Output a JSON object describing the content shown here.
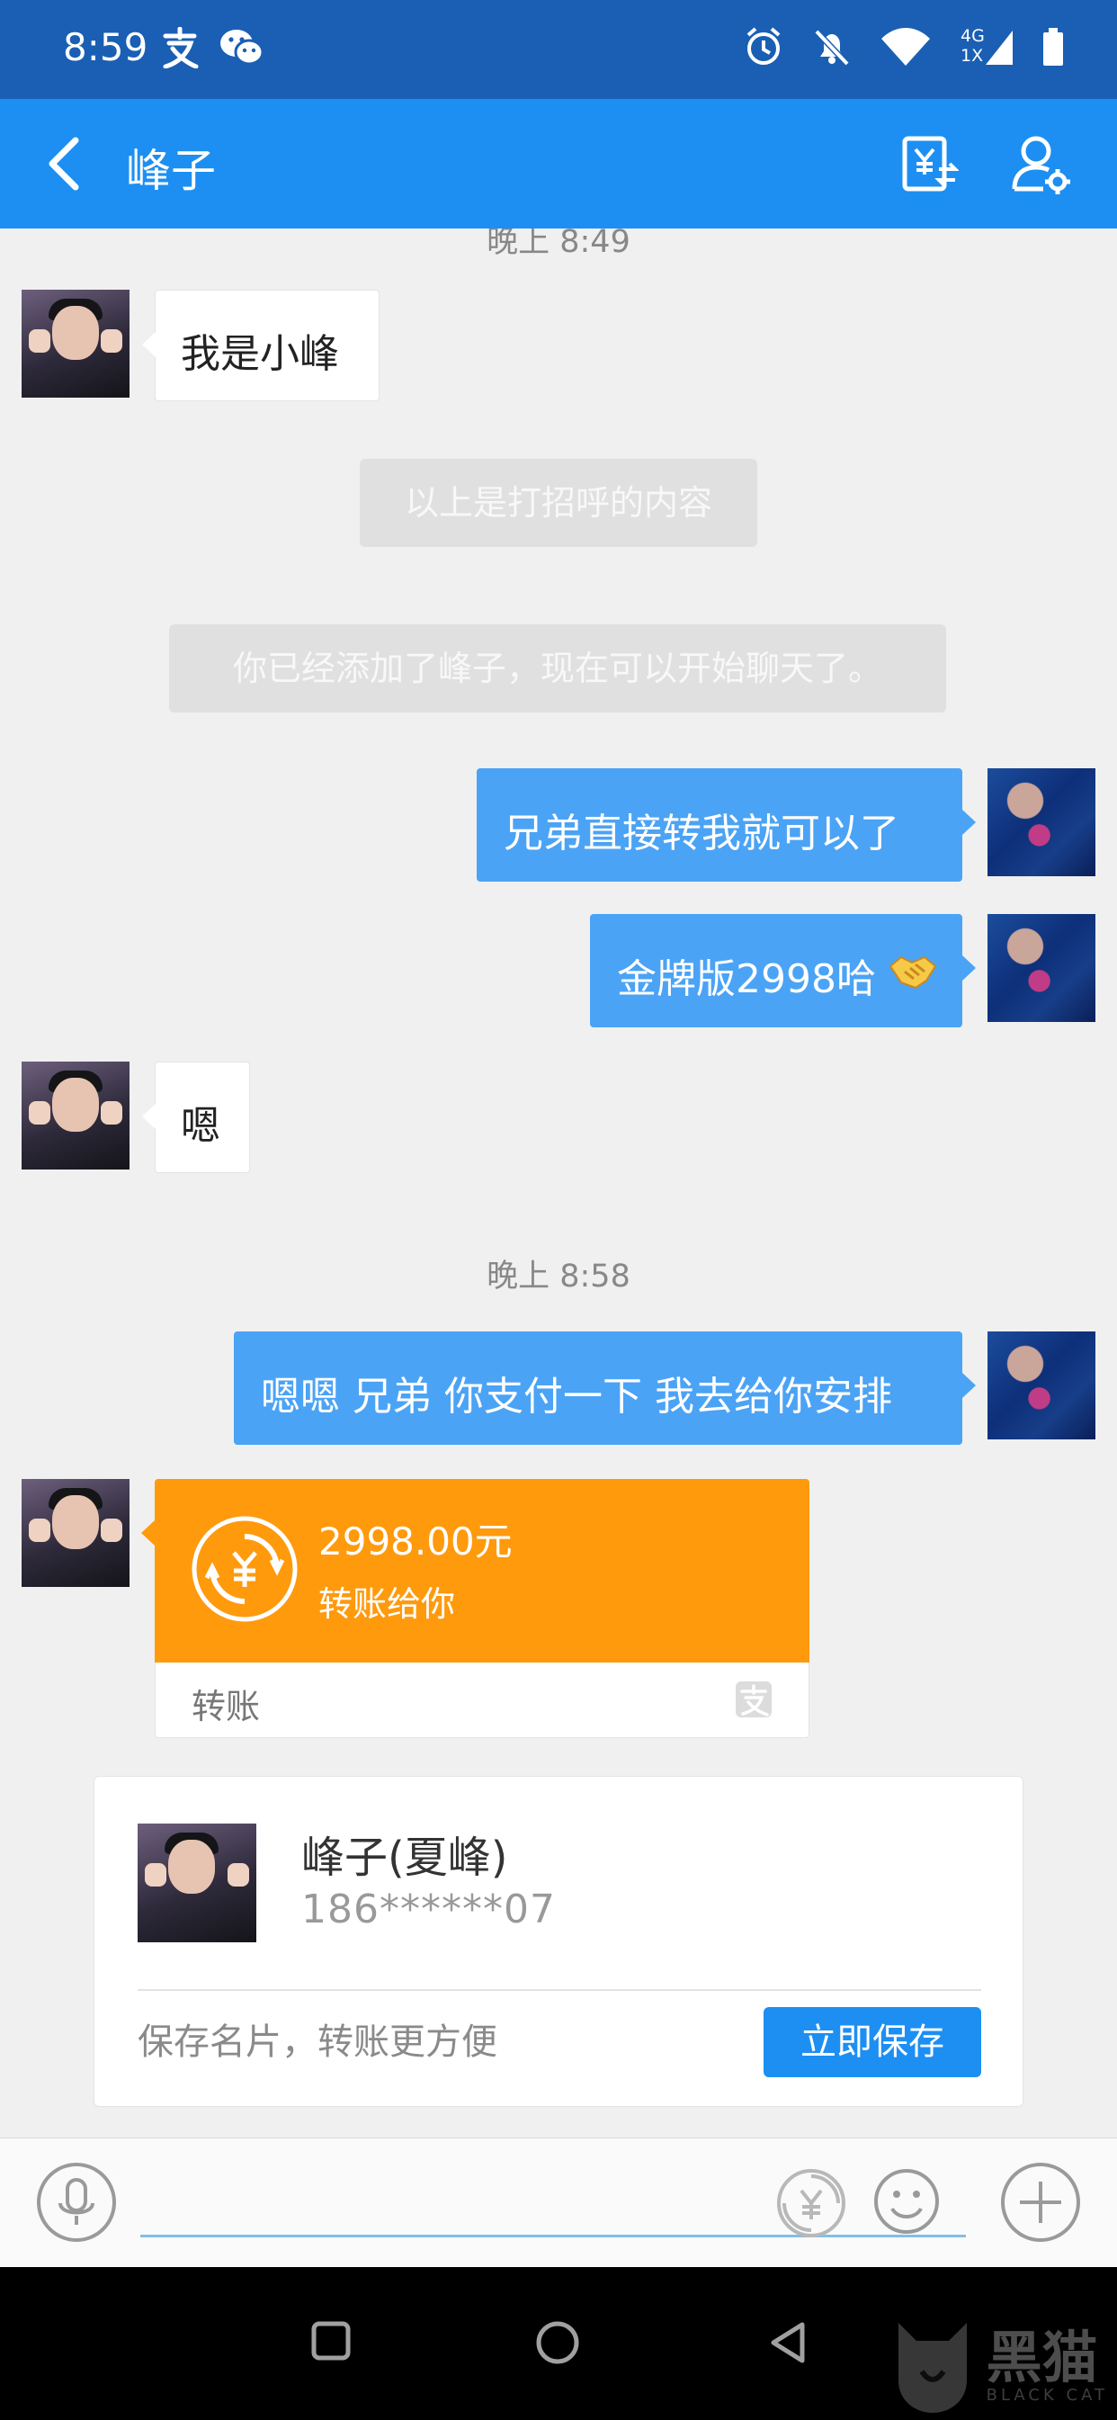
{
  "status_bar": {
    "time": "8:59",
    "network_top": "4G",
    "network_bottom": "1X"
  },
  "header": {
    "title": "峰子"
  },
  "messages": {
    "clipped_timestamp": "晚上 8:49",
    "m1": "我是小峰",
    "sys1": "以上是打招呼的内容",
    "sys2": "你已经添加了峰子，现在可以开始聊天了。",
    "m2": "兄弟直接转我就可以了",
    "m3": "金牌版2998哈",
    "m4": "嗯",
    "timestamp2": "晚上 8:58",
    "m5": "嗯嗯 兄弟 你支付一下 我去给你安排"
  },
  "transfer": {
    "amount": "2998.00元",
    "desc": "转账给你",
    "label": "转账"
  },
  "contact_card": {
    "name": "峰子(夏峰)",
    "phone": "186******07",
    "tip": "保存名片，转账更方便",
    "save_label": "立即保存"
  },
  "input": {
    "placeholder": ""
  },
  "watermark": {
    "main": "黑猫",
    "sub": "BLACK CAT"
  },
  "colors": {
    "status_bar": "#1a5fb4",
    "title_bar": "#1d8ff2",
    "bubble_right": "#4ba3f5",
    "transfer": "#ff9a0d"
  }
}
